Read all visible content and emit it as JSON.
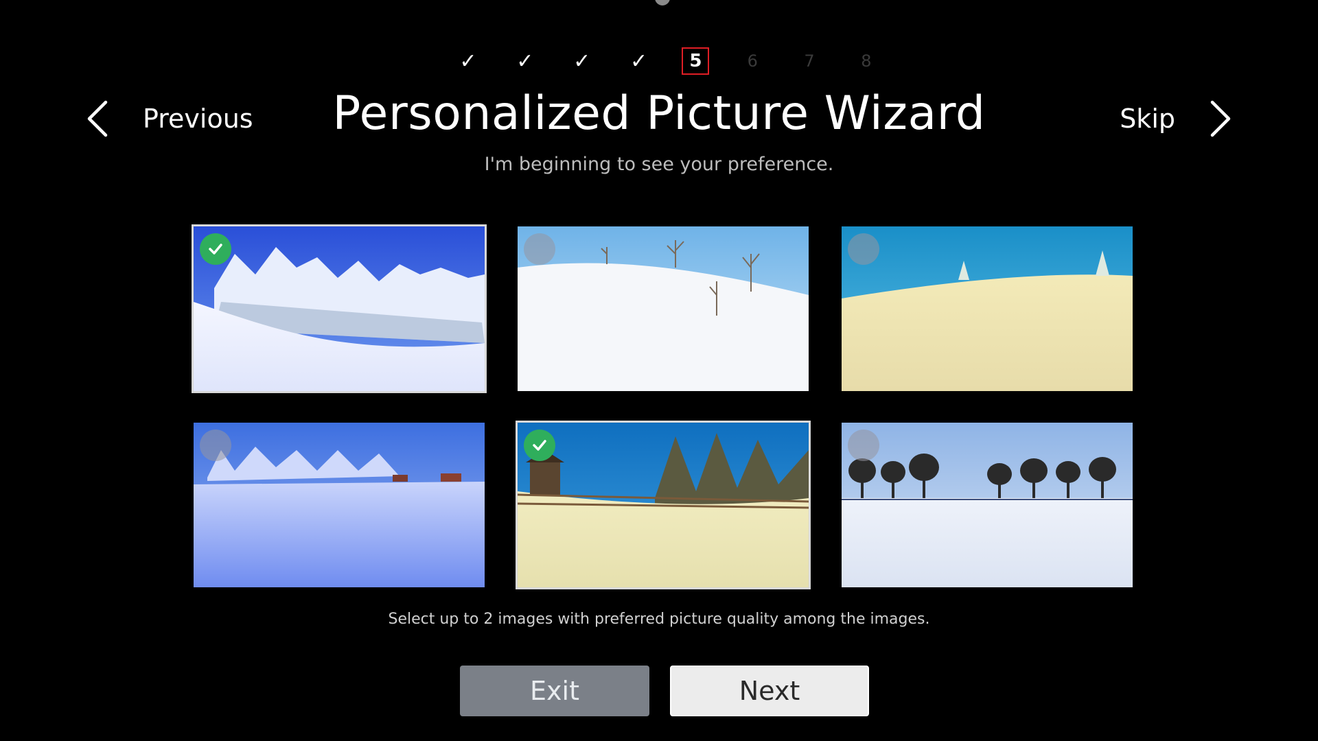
{
  "wizard": {
    "title": "Personalized Picture Wizard",
    "subtitle": "I'm beginning to see your preference.",
    "instruction": "Select up to 2 images with preferred picture quality among the images."
  },
  "steps": [
    {
      "label": "✓",
      "state": "done"
    },
    {
      "label": "✓",
      "state": "done"
    },
    {
      "label": "✓",
      "state": "done"
    },
    {
      "label": "✓",
      "state": "done"
    },
    {
      "label": "5",
      "state": "current"
    },
    {
      "label": "6",
      "state": "pending"
    },
    {
      "label": "7",
      "state": "pending"
    },
    {
      "label": "8",
      "state": "pending"
    }
  ],
  "nav": {
    "previous_label": "Previous",
    "skip_label": "Skip",
    "previous_icon": "chevron-left-icon",
    "skip_icon": "chevron-right-icon"
  },
  "images": [
    {
      "id": "winter-forest-blue",
      "selected": true
    },
    {
      "id": "snowy-hill-bright",
      "selected": false
    },
    {
      "id": "snowy-hill-warm",
      "selected": false
    },
    {
      "id": "snow-field-blue",
      "selected": false
    },
    {
      "id": "fence-hut-warm",
      "selected": true
    },
    {
      "id": "tree-row-neutral",
      "selected": false
    }
  ],
  "buttons": {
    "exit_label": "Exit",
    "next_label": "Next"
  },
  "colors": {
    "current_step_border": "#e01e25",
    "selected_check": "#2fae5c",
    "exit_button": "#7b8088",
    "next_button": "#ececec"
  }
}
